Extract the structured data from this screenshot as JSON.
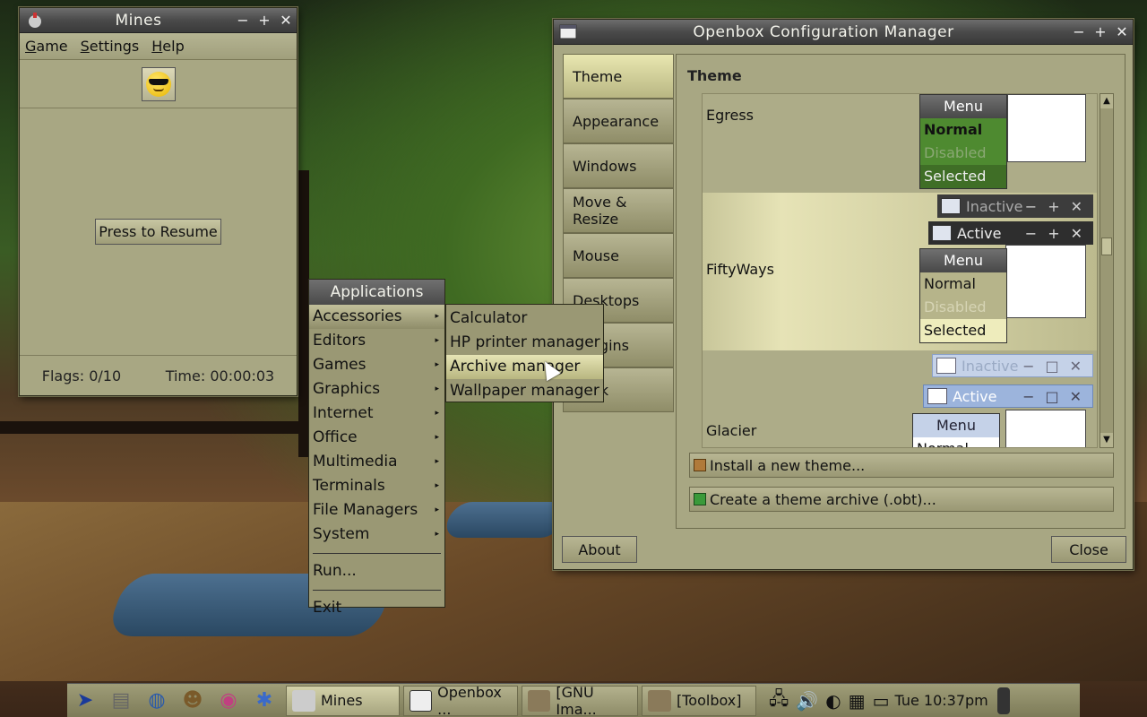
{
  "mines": {
    "title": "Mines",
    "menu": [
      "Game",
      "Settings",
      "Help"
    ],
    "resume_label": "Press to Resume",
    "flags": "Flags: 0/10",
    "time": "Time: 00:00:03"
  },
  "obconf": {
    "title": "Openbox Configuration Manager",
    "tabs": [
      "Theme",
      "Appearance",
      "Windows",
      "Move & Resize",
      "Mouse",
      "Desktops",
      "Margins",
      "Dock"
    ],
    "panel_title": "Theme",
    "themes": [
      {
        "name": "Egress",
        "menu": [
          "Menu",
          "Normal",
          "Disabled",
          "Selected"
        ]
      },
      {
        "name": "FiftyWays",
        "inactive": "Inactive",
        "active": "Active",
        "menu": [
          "Menu",
          "Normal",
          "Disabled",
          "Selected"
        ]
      },
      {
        "name": "Glacier",
        "inactive": "Inactive",
        "active": "Active",
        "menu": [
          "Menu",
          "Normal"
        ]
      }
    ],
    "install_label": "Install a new theme...",
    "archive_label": "Create a theme archive (.obt)...",
    "about_label": "About",
    "close_label": "Close"
  },
  "appmenu": {
    "title": "Applications",
    "items": [
      "Accessories",
      "Editors",
      "Games",
      "Graphics",
      "Internet",
      "Office",
      "Multimedia",
      "Terminals",
      "File Managers",
      "System"
    ],
    "run": "Run...",
    "exit": "Exit",
    "submenu": [
      "Calculator",
      "HP printer manager",
      "Archive manager",
      "Wallpaper manager"
    ]
  },
  "taskbar": {
    "tasks": [
      "Mines",
      "Openbox ...",
      "[GNU Ima...",
      "[Toolbox]"
    ],
    "clock": "Tue 10:37pm"
  },
  "colors": {
    "panel": "#a8a783",
    "titlebar": "#4a4a4a",
    "highlight": "#e6e4b5"
  }
}
